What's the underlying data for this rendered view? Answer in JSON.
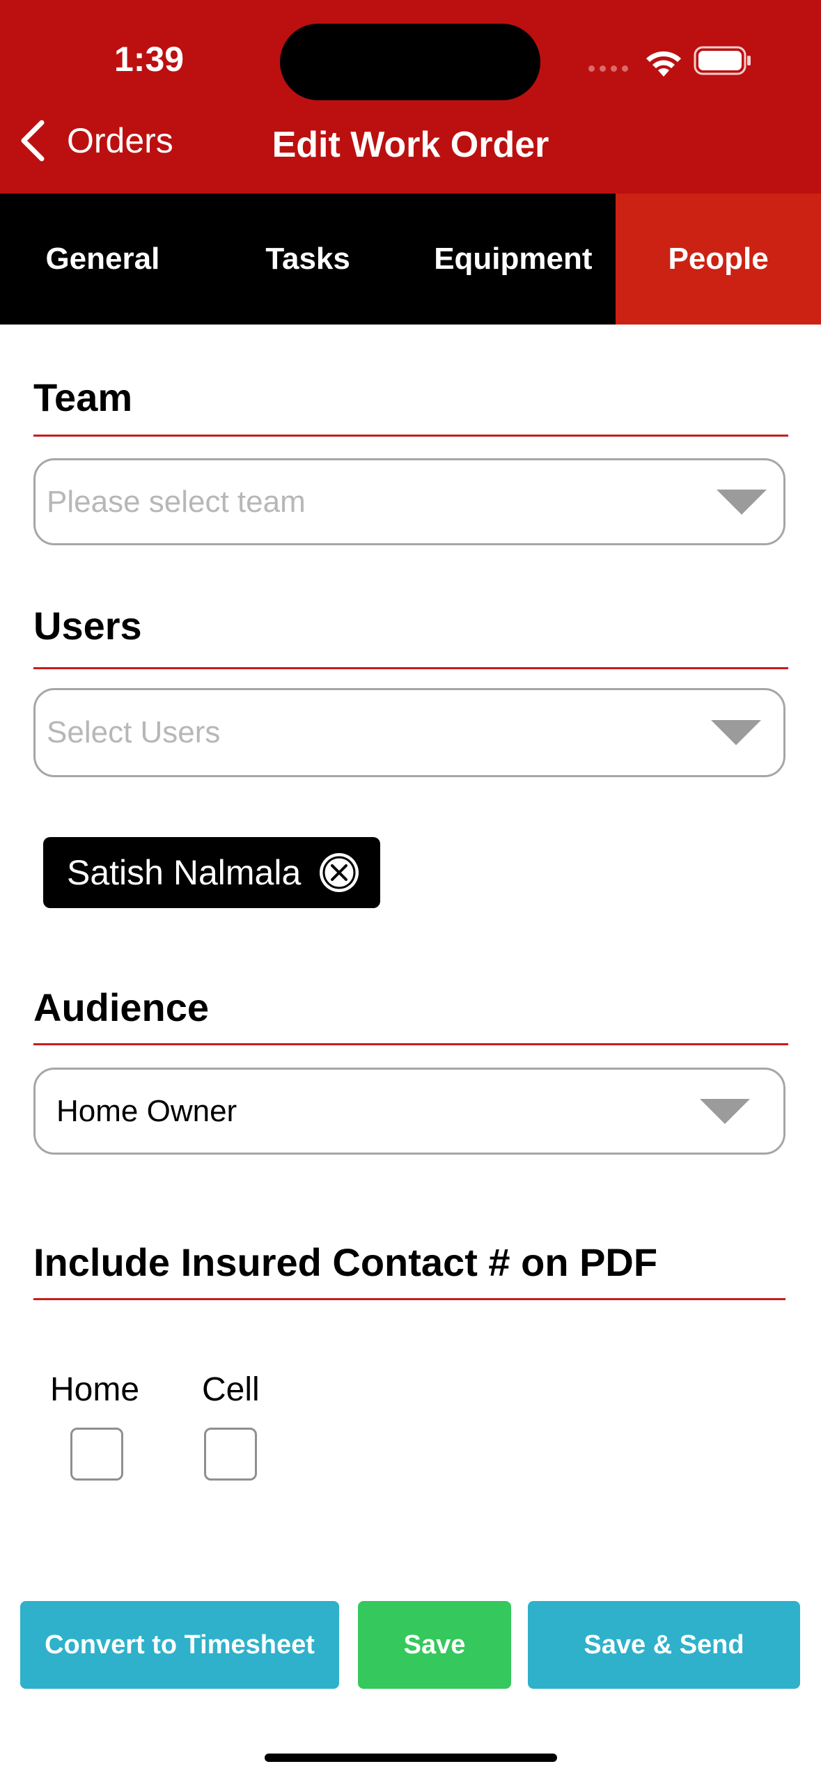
{
  "status_bar": {
    "time": "1:39"
  },
  "nav": {
    "back_label": "Orders",
    "title": "Edit Work Order"
  },
  "tabs": [
    {
      "label": "General",
      "active": false
    },
    {
      "label": "Tasks",
      "active": false
    },
    {
      "label": "Equipment",
      "active": false
    },
    {
      "label": "People",
      "active": true
    }
  ],
  "team": {
    "title": "Team",
    "placeholder": "Please select team"
  },
  "users": {
    "title": "Users",
    "placeholder": "Select Users",
    "selected": [
      "Satish Nalmala"
    ]
  },
  "audience": {
    "title": "Audience",
    "value": "Home Owner"
  },
  "insured_contact": {
    "title": "Include Insured Contact # on PDF",
    "options": [
      {
        "label": "Home",
        "checked": false
      },
      {
        "label": "Cell",
        "checked": false
      }
    ]
  },
  "buttons": {
    "convert": "Convert to Timesheet",
    "save": "Save",
    "save_send": "Save & Send"
  },
  "colors": {
    "header_red": "#bc1010",
    "active_tab": "#cc2213",
    "rule_red": "#c91c1c",
    "teal": "#2fb1cb",
    "green": "#35c85c"
  },
  "icons": [
    "chevron-left-icon",
    "wifi-icon",
    "battery-icon",
    "signal-icon",
    "dropdown-caret-icon",
    "remove-circle-x-icon"
  ]
}
